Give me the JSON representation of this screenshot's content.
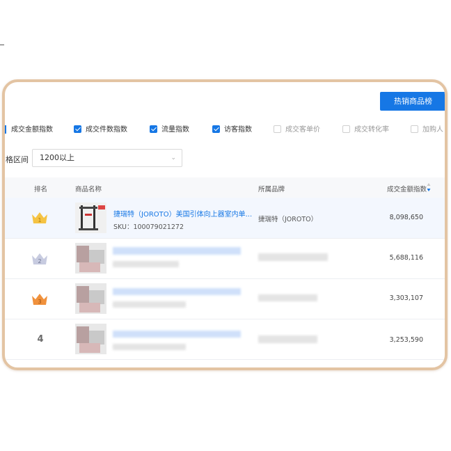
{
  "toolbar": {
    "hot_button": "热销商品榜"
  },
  "metrics": [
    {
      "label": "成交金额指数",
      "checked": true
    },
    {
      "label": "成交件数指数",
      "checked": true
    },
    {
      "label": "流量指数",
      "checked": true
    },
    {
      "label": "访客指数",
      "checked": true
    },
    {
      "label": "成交客单价",
      "checked": false
    },
    {
      "label": "成交转化率",
      "checked": false
    },
    {
      "label": "加购人",
      "checked": false
    }
  ],
  "filter": {
    "label": "格区间",
    "value": "1200以上"
  },
  "table": {
    "headers": {
      "rank": "排名",
      "product": "商品名称",
      "brand": "所属品牌",
      "amount": "成交金额指数"
    },
    "rows": [
      {
        "rank": "1",
        "title": "捷瑞特（JOROTO）美国引体向上器室内单...",
        "sku": "SKU：100079021272",
        "brand": "捷瑞特（JOROTO）",
        "amount": "8,098,650"
      },
      {
        "rank": "2",
        "amount": "5,688,116"
      },
      {
        "rank": "3",
        "amount": "3,303,107"
      },
      {
        "rank": "4",
        "amount": "3,253,590"
      }
    ]
  },
  "colors": {
    "accent": "#1677e5",
    "gold": "#f5c343",
    "silver": "#c7cbe0",
    "bronze": "#f0913c"
  },
  "icons": {
    "rank1": "crown-gold-icon",
    "rank2": "crown-silver-icon",
    "rank3": "crown-bronze-icon",
    "sort": "sort-icon"
  }
}
